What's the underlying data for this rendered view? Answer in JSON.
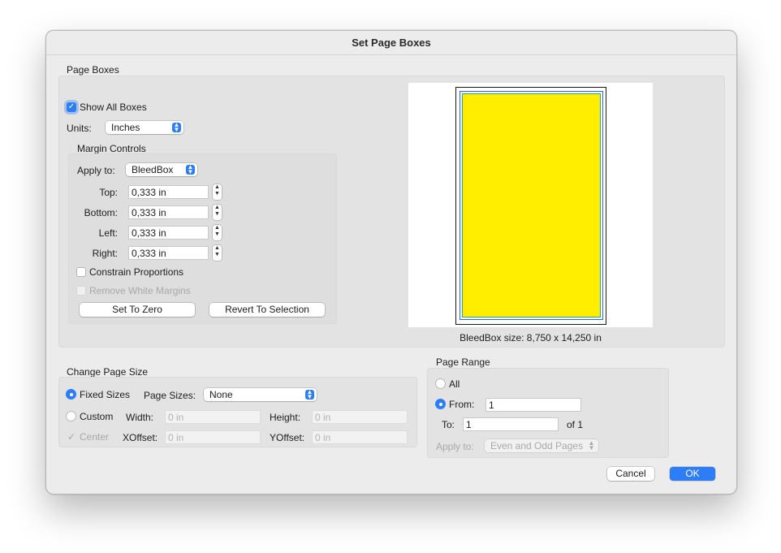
{
  "window": {
    "title": "Set Page Boxes"
  },
  "page_boxes": {
    "section_label": "Page Boxes",
    "show_all_boxes": {
      "label": "Show All Boxes",
      "checked": true
    },
    "units": {
      "label": "Units:",
      "value": "Inches"
    },
    "margin_controls": {
      "label": "Margin Controls",
      "apply_to": {
        "label": "Apply to:",
        "value": "BleedBox"
      },
      "top": {
        "label": "Top:",
        "value": "0,333 in"
      },
      "bottom": {
        "label": "Bottom:",
        "value": "0,333 in"
      },
      "left": {
        "label": "Left:",
        "value": "0,333 in"
      },
      "right": {
        "label": "Right:",
        "value": "0,333 in"
      },
      "constrain_proportions": {
        "label": "Constrain Proportions",
        "checked": false
      },
      "remove_white_margins": {
        "label": "Remove White Margins",
        "checked": false,
        "enabled": false
      },
      "set_to_zero_label": "Set To Zero",
      "revert_to_selection_label": "Revert To Selection"
    },
    "preview": {
      "page_fill_color": "#ffee00",
      "box_color": "#2f66d8",
      "size_text": "BleedBox size: 8,750 x 14,250 in"
    }
  },
  "change_page_size": {
    "section_label": "Change Page Size",
    "fixed_sizes": {
      "label": "Fixed Sizes",
      "selected": true
    },
    "page_sizes": {
      "label": "Page Sizes:",
      "value": "None"
    },
    "custom": {
      "label": "Custom",
      "selected": false
    },
    "width": {
      "label": "Width:",
      "value": "0 in"
    },
    "height": {
      "label": "Height:",
      "value": "0 in"
    },
    "center": {
      "label": "Center",
      "checked": true,
      "enabled": false
    },
    "xoffset": {
      "label": "XOffset:",
      "value": "0 in"
    },
    "yoffset": {
      "label": "YOffset:",
      "value": "0 in"
    }
  },
  "page_range": {
    "section_label": "Page Range",
    "all": {
      "label": "All",
      "selected": false
    },
    "from": {
      "label": "From:",
      "value": "1",
      "selected": true
    },
    "to": {
      "label": "To:",
      "value": "1"
    },
    "of_text": "of 1",
    "apply_to": {
      "label": "Apply to:",
      "value": "Even and Odd Pages"
    }
  },
  "footer": {
    "cancel_label": "Cancel",
    "ok_label": "OK"
  },
  "colors": {
    "accent": "#2d7df6"
  }
}
